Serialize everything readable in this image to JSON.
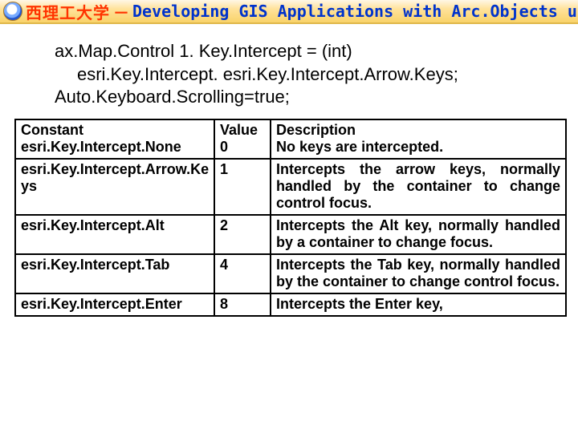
{
  "header": {
    "university_cn_visible": "西理工大学",
    "separator": "－",
    "course_title_en": "Developing GIS Applications with Arc.Objects using C#. NE"
  },
  "code": {
    "l1": "ax.Map.Control 1. Key.Intercept = (int)",
    "l2": "esri.Key.Intercept. esri.Key.Intercept.Arrow.Keys;",
    "l3": "Auto.Keyboard.Scrolling=true;"
  },
  "table": {
    "headers": {
      "c1": "Constant",
      "c2": "Value",
      "c3": "Description"
    },
    "rows": [
      {
        "const": "esri.Key.Intercept.None",
        "value": "0",
        "desc": "No keys are intercepted."
      },
      {
        "const": "esri.Key.Intercept.Arrow.Ke ys",
        "value": "1",
        "desc": "Intercepts the arrow keys, normally handled by the container to change control focus."
      },
      {
        "const": "esri.Key.Intercept.Alt",
        "value": "2",
        "desc": "Intercepts the Alt key, normally handled by a container to change focus."
      },
      {
        "const": "esri.Key.Intercept.Tab",
        "value": "4",
        "desc": "Intercepts the Tab key, normally handled by the container to change control focus."
      },
      {
        "const": "esri.Key.Intercept.Enter",
        "value": "8",
        "desc": "Intercepts the Enter key,"
      }
    ]
  }
}
